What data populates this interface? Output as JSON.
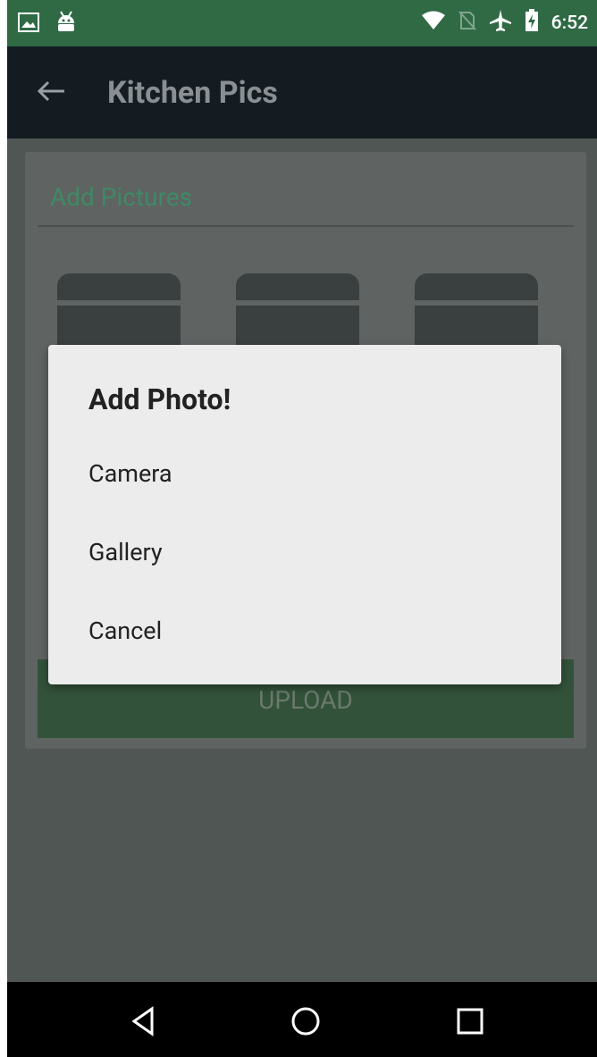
{
  "status_bar": {
    "time": "6:52",
    "icons": [
      "image-icon",
      "android-icon",
      "wifi-icon",
      "no-sim-icon",
      "airplane-mode-icon",
      "battery-charging-icon"
    ]
  },
  "app_bar": {
    "back_icon": "arrow-back-icon",
    "title": "Kitchen Pics"
  },
  "card": {
    "title": "Add Pictures",
    "upload_label": "UPLOAD"
  },
  "dialog": {
    "title": "Add Photo!",
    "options": [
      "Camera",
      "Gallery",
      "Cancel"
    ]
  },
  "nav_bar": {
    "buttons": [
      "back-triangle-icon",
      "home-circle-icon",
      "recents-square-icon"
    ]
  },
  "colors": {
    "status_bar": "#2f6a45",
    "app_bar": "#141c22",
    "scrim": "#4f5654",
    "accent": "#3f8a66",
    "dialog": "#ececec"
  }
}
